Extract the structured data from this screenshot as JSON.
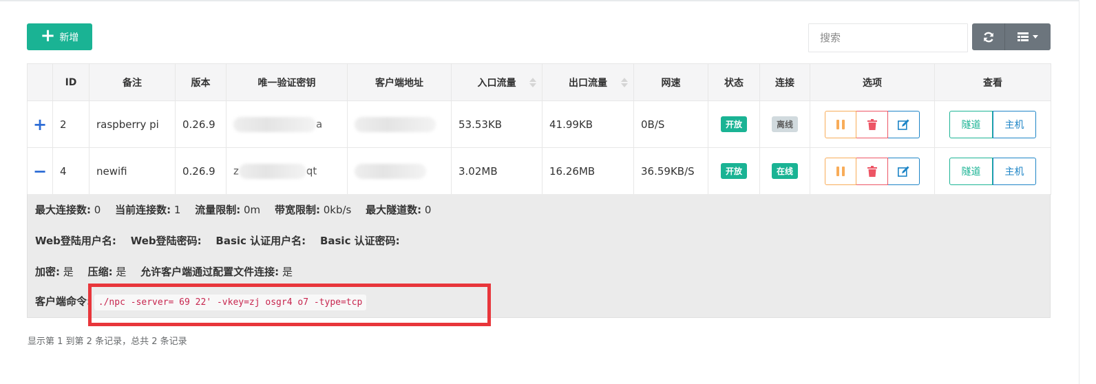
{
  "toolbar": {
    "add_label": "新增",
    "search_placeholder": "搜索",
    "refresh_icon": "refresh-icon",
    "columns_icon": "list-icon"
  },
  "table": {
    "headers": [
      "",
      "ID",
      "备注",
      "版本",
      "唯一验证密钥",
      "客户端地址",
      "入口流量",
      "出口流量",
      "网速",
      "状态",
      "连接",
      "选项",
      "查看"
    ],
    "rows": [
      {
        "expander": "+",
        "id": "2",
        "remark": "raspberry pi",
        "version": "0.26.9",
        "key_visible": "a",
        "addr_visible": "",
        "in_flow": "53.53KB",
        "out_flow": "41.99KB",
        "speed": "0B/S",
        "status": "开放",
        "conn": "离线",
        "tunnel": "隧道",
        "host": "主机"
      },
      {
        "expander": "−",
        "id": "4",
        "remark": "newifi",
        "version": "0.26.9",
        "key_visible": "z",
        "key_visible_end": "qt",
        "addr_visible": "",
        "in_flow": "3.02MB",
        "out_flow": "16.26MB",
        "speed": "36.59KB/S",
        "status": "开放",
        "conn": "在线",
        "tunnel": "隧道",
        "host": "主机"
      }
    ]
  },
  "detail": {
    "max_conn_label": "最大连接数:",
    "max_conn": "0",
    "cur_conn_label": "当前连接数:",
    "cur_conn": "1",
    "flow_limit_label": "流量限制:",
    "flow_limit": "0m",
    "rate_limit_label": "带宽限制:",
    "rate_limit": "0kb/s",
    "max_tunnel_label": "最大隧道数:",
    "max_tunnel": "0",
    "web_user_label": "Web登陆用户名:",
    "web_pass_label": "Web登陆密码:",
    "basic_user_label": "Basic 认证用户名:",
    "basic_pass_label": "Basic 认证密码:",
    "crypt_label": "加密:",
    "crypt": "是",
    "compress_label": "压缩:",
    "compress": "是",
    "config_conn_label": "允许客户端通过配置文件连接:",
    "config_conn": "是",
    "cmd_label": "客户端命令:",
    "cmd": "./npc -server=   69    22'      -vkey=zj    osgr4    o7 -type=tcp"
  },
  "footer": {
    "summary": "显示第 1 到第 2 条记录，总共 2 条记录"
  },
  "colors": {
    "primary": "#1ab394",
    "warning": "#f8ac59",
    "danger": "#ed5565",
    "info": "#1c84c6",
    "highlight_box": "#e8363b"
  }
}
